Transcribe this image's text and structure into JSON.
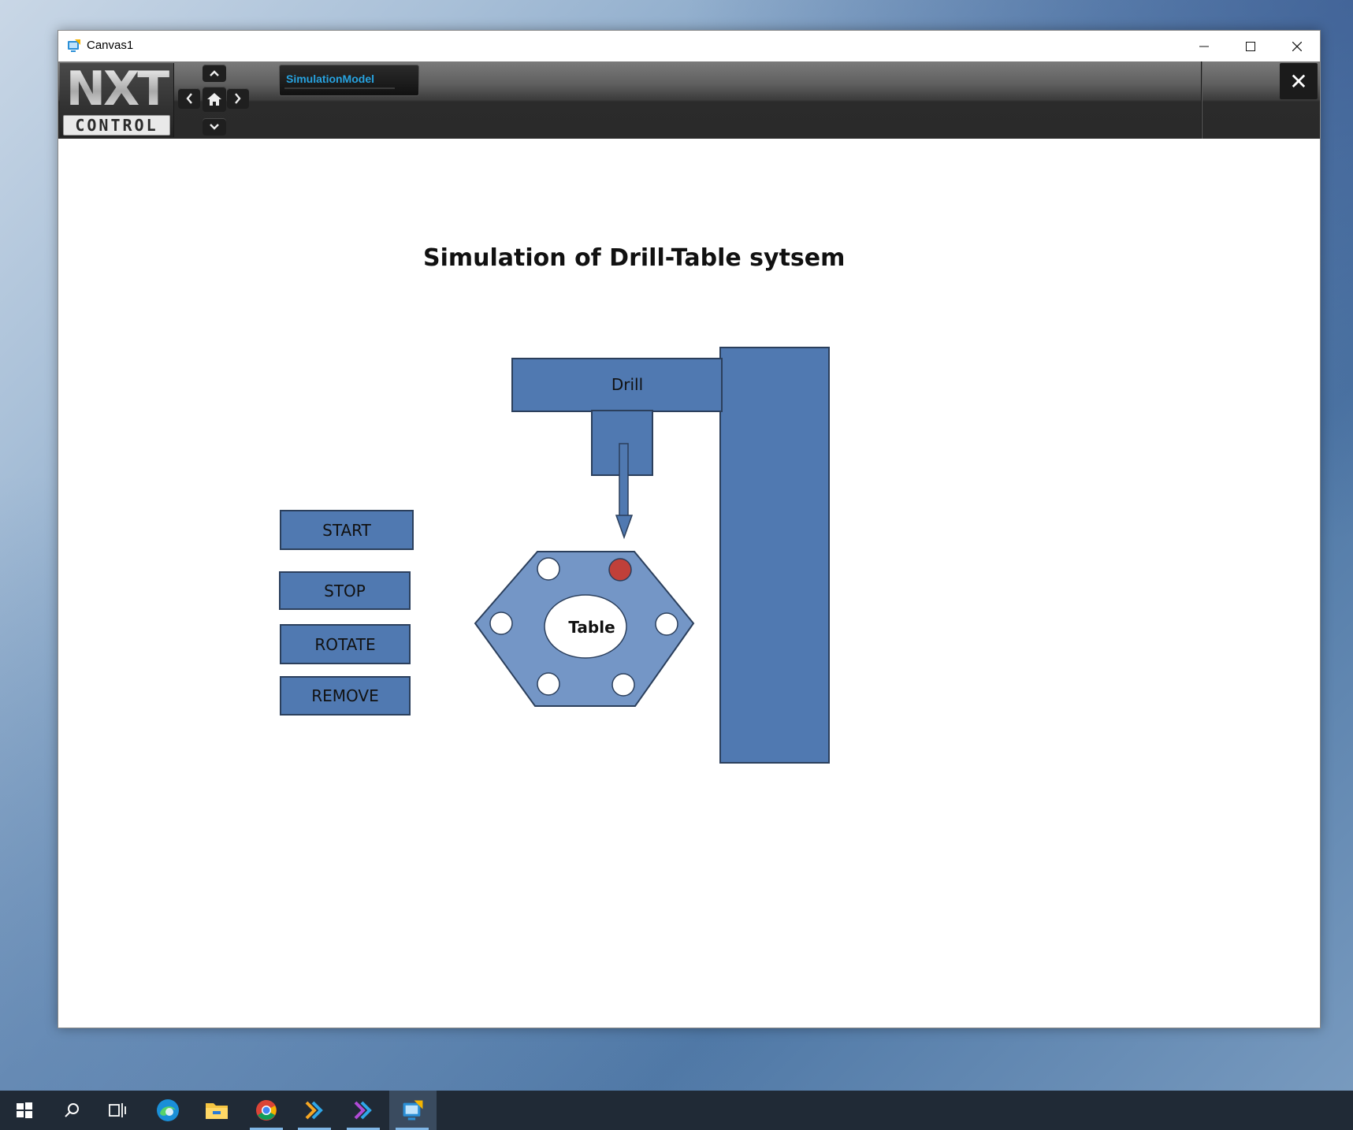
{
  "window": {
    "title": "Canvas1",
    "controls": {
      "minimize": "—",
      "maximize": "☐",
      "close": "✕"
    }
  },
  "toolbar": {
    "logo_top": "NXT",
    "logo_bottom": "CONTROL",
    "nav": {
      "up": "⌃",
      "down": "⌄",
      "left": "❮",
      "right": "❯",
      "home": "⌂"
    },
    "tab_label": "SimulationModel",
    "close_label": "✕"
  },
  "canvas": {
    "title": "Simulation of Drill-Table sytsem",
    "buttons": {
      "start": "START",
      "stop": "STOP",
      "rotate": "ROTATE",
      "remove": "REMOVE"
    },
    "drill_label": "Drill",
    "table_label": "Table",
    "colors": {
      "steel_blue": "#5079b1",
      "table_blue": "#7496c6",
      "border": "#2b3f5c",
      "active_hole": "#c0403a"
    }
  },
  "taskbar": {
    "items": [
      "windows-start-icon",
      "search-icon",
      "task-view-icon",
      "edge-icon",
      "file-explorer-icon",
      "chrome-icon",
      "nxt-ide-icon",
      "nxt-ide-2-icon",
      "canvas-app-icon"
    ]
  }
}
